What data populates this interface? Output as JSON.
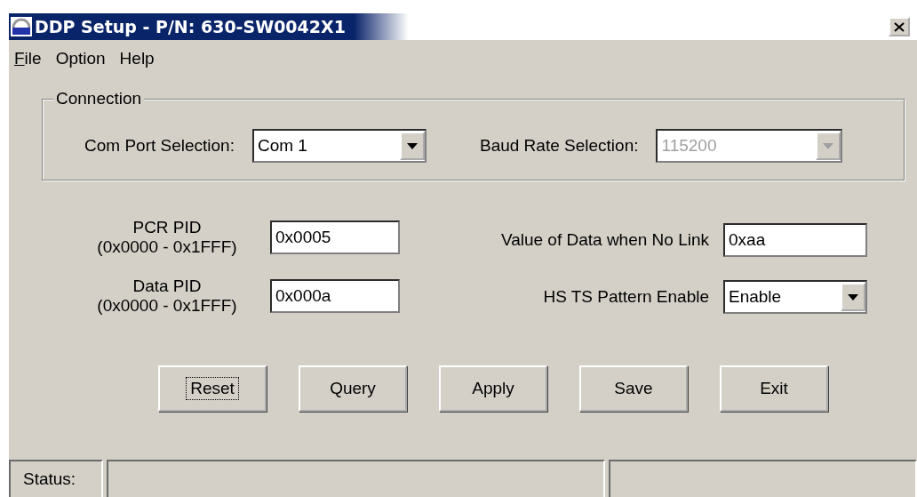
{
  "window": {
    "title": "DDP Setup - P/N: 630-SW0042X1"
  },
  "menu": [
    {
      "label": "File",
      "mnemonic": true
    },
    {
      "label": "Option",
      "mnemonic": false
    },
    {
      "label": "Help",
      "mnemonic": false
    }
  ],
  "connection": {
    "title": "Connection",
    "fields": [
      {
        "label": "Com Port Selection:",
        "value": "Com 1",
        "disabled": false
      },
      {
        "label": "Baud Rate Selection:",
        "value": "115200",
        "disabled": true
      }
    ]
  },
  "left_fields": [
    {
      "kind": "text",
      "label": "PCR PID",
      "range": "(0x0000 - 0x1FFF)",
      "value": "0x0005"
    },
    {
      "kind": "text",
      "label": "Data PID",
      "range": "(0x0000 - 0x1FFF)",
      "value": "0x000a"
    }
  ],
  "right_fields": [
    {
      "kind": "text",
      "label": "Value of Data when No Link",
      "value": "0xaa"
    },
    {
      "kind": "dropdown",
      "label": "HS TS Pattern Enable",
      "value": "Enable"
    }
  ],
  "buttons": [
    {
      "label": "Reset",
      "focused": true
    },
    {
      "label": "Query",
      "focused": false
    },
    {
      "label": "Apply",
      "focused": false
    },
    {
      "label": "Save",
      "focused": false
    },
    {
      "label": "Exit",
      "focused": false
    }
  ],
  "status_bar": {
    "label": "Status:"
  }
}
